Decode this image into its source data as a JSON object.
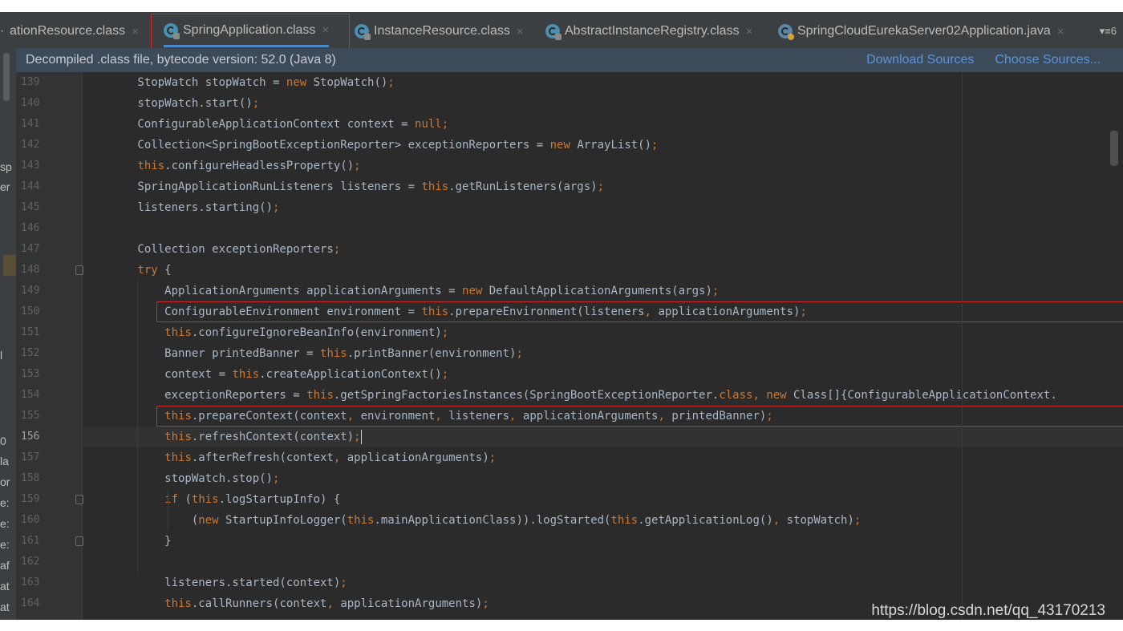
{
  "tabs": [
    {
      "label": "ationResource.class",
      "kind": "class",
      "active": false
    },
    {
      "label": "SpringApplication.class",
      "kind": "class",
      "active": true
    },
    {
      "label": "InstanceResource.class",
      "kind": "class",
      "active": false
    },
    {
      "label": "AbstractInstanceRegistry.class",
      "kind": "class",
      "active": false
    },
    {
      "label": "SpringCloudEurekaServer02Application.java",
      "kind": "java",
      "active": false
    }
  ],
  "tab_close_glyph": "×",
  "tab_overflow_label": "▾≡6",
  "left_cut_glyph": "·",
  "banner": {
    "text": "Decompiled .class file, bytecode version: 52.0 (Java 8)",
    "download_sources": "Download Sources",
    "choose_sources": "Choose Sources..."
  },
  "left_strip_fragments": [
    "sp",
    "er",
    "l",
    "0",
    "la",
    "or",
    "e:",
    "e:",
    "e:",
    "af",
    "at",
    "at"
  ],
  "code_lines": [
    {
      "num": "139",
      "tokens": [
        [
          "nm",
          "        StopWatch stopWatch = "
        ],
        [
          "kw",
          "new "
        ],
        [
          "nm",
          "StopWatch()"
        ],
        [
          "pu",
          ";"
        ]
      ]
    },
    {
      "num": "140",
      "tokens": [
        [
          "nm",
          "        stopWatch.start()"
        ],
        [
          "pu",
          ";"
        ]
      ]
    },
    {
      "num": "141",
      "tokens": [
        [
          "nm",
          "        ConfigurableApplicationContext context = "
        ],
        [
          "kw",
          "null"
        ],
        [
          "pu",
          ";"
        ]
      ]
    },
    {
      "num": "142",
      "tokens": [
        [
          "nm",
          "        Collection<SpringBootExceptionReporter> exceptionReporters = "
        ],
        [
          "kw",
          "new "
        ],
        [
          "nm",
          "ArrayList()"
        ],
        [
          "pu",
          ";"
        ]
      ]
    },
    {
      "num": "143",
      "tokens": [
        [
          "nm",
          "        "
        ],
        [
          "kw",
          "this"
        ],
        [
          "nm",
          ".configureHeadlessProperty()"
        ],
        [
          "pu",
          ";"
        ]
      ]
    },
    {
      "num": "144",
      "tokens": [
        [
          "nm",
          "        SpringApplicationRunListeners listeners = "
        ],
        [
          "kw",
          "this"
        ],
        [
          "nm",
          ".getRunListeners(args)"
        ],
        [
          "pu",
          ";"
        ]
      ]
    },
    {
      "num": "145",
      "tokens": [
        [
          "nm",
          "        listeners.starting()"
        ],
        [
          "pu",
          ";"
        ]
      ]
    },
    {
      "num": "146",
      "tokens": []
    },
    {
      "num": "147",
      "tokens": [
        [
          "nm",
          "        Collection exceptionReporters"
        ],
        [
          "pu",
          ";"
        ]
      ]
    },
    {
      "num": "148",
      "tokens": [
        [
          "nm",
          "        "
        ],
        [
          "kw",
          "try "
        ],
        [
          "nm",
          "{"
        ]
      ]
    },
    {
      "num": "149",
      "tokens": [
        [
          "nm",
          "            ApplicationArguments applicationArguments = "
        ],
        [
          "kw",
          "new "
        ],
        [
          "nm",
          "DefaultApplicationArguments(args)"
        ],
        [
          "pu",
          ";"
        ]
      ]
    },
    {
      "num": "150",
      "tokens": [
        [
          "nm",
          "            ConfigurableEnvironment environment = "
        ],
        [
          "kw",
          "this"
        ],
        [
          "nm",
          ".prepareEnvironment(listeners"
        ],
        [
          "pu",
          ", "
        ],
        [
          "nm",
          "applicationArguments)"
        ],
        [
          "pu",
          ";"
        ]
      ]
    },
    {
      "num": "151",
      "tokens": [
        [
          "nm",
          "            "
        ],
        [
          "kw",
          "this"
        ],
        [
          "nm",
          ".configureIgnoreBeanInfo(environment)"
        ],
        [
          "pu",
          ";"
        ]
      ]
    },
    {
      "num": "152",
      "tokens": [
        [
          "nm",
          "            Banner printedBanner = "
        ],
        [
          "kw",
          "this"
        ],
        [
          "nm",
          ".printBanner(environment)"
        ],
        [
          "pu",
          ";"
        ]
      ]
    },
    {
      "num": "153",
      "tokens": [
        [
          "nm",
          "            context = "
        ],
        [
          "kw",
          "this"
        ],
        [
          "nm",
          ".createApplicationContext()"
        ],
        [
          "pu",
          ";"
        ]
      ]
    },
    {
      "num": "154",
      "tokens": [
        [
          "nm",
          "            exceptionReporters = "
        ],
        [
          "kw",
          "this"
        ],
        [
          "nm",
          ".getSpringFactoriesInstances(SpringBootExceptionReporter."
        ],
        [
          "kw",
          "class"
        ],
        [
          "pu",
          ", "
        ],
        [
          "kw",
          "new "
        ],
        [
          "nm",
          "Class[]{ConfigurableApplicationContext."
        ]
      ]
    },
    {
      "num": "155",
      "tokens": [
        [
          "nm",
          "            "
        ],
        [
          "kw",
          "this"
        ],
        [
          "nm",
          ".prepareContext(context"
        ],
        [
          "pu",
          ", "
        ],
        [
          "nm",
          "environment"
        ],
        [
          "pu",
          ", "
        ],
        [
          "nm",
          "listeners"
        ],
        [
          "pu",
          ", "
        ],
        [
          "nm",
          "applicationArguments"
        ],
        [
          "pu",
          ", "
        ],
        [
          "nm",
          "printedBanner)"
        ],
        [
          "pu",
          ";"
        ]
      ]
    },
    {
      "num": "156",
      "tokens": [
        [
          "nm",
          "            "
        ],
        [
          "kw",
          "this"
        ],
        [
          "nm",
          ".refreshContext(context)"
        ],
        [
          "pu",
          ";"
        ]
      ]
    },
    {
      "num": "157",
      "tokens": [
        [
          "nm",
          "            "
        ],
        [
          "kw",
          "this"
        ],
        [
          "nm",
          ".afterRefresh(context"
        ],
        [
          "pu",
          ", "
        ],
        [
          "nm",
          "applicationArguments)"
        ],
        [
          "pu",
          ";"
        ]
      ]
    },
    {
      "num": "158",
      "tokens": [
        [
          "nm",
          "            stopWatch.stop()"
        ],
        [
          "pu",
          ";"
        ]
      ]
    },
    {
      "num": "159",
      "tokens": [
        [
          "nm",
          "            "
        ],
        [
          "kw",
          "if "
        ],
        [
          "nm",
          "("
        ],
        [
          "kw",
          "this"
        ],
        [
          "nm",
          ".logStartupInfo) {"
        ]
      ]
    },
    {
      "num": "160",
      "tokens": [
        [
          "nm",
          "                ("
        ],
        [
          "kw",
          "new "
        ],
        [
          "nm",
          "StartupInfoLogger("
        ],
        [
          "kw",
          "this"
        ],
        [
          "nm",
          ".mainApplicationClass)).logStarted("
        ],
        [
          "kw",
          "this"
        ],
        [
          "nm",
          ".getApplicationLog()"
        ],
        [
          "pu",
          ", "
        ],
        [
          "nm",
          "stopWatch)"
        ],
        [
          "pu",
          ";"
        ]
      ]
    },
    {
      "num": "161",
      "tokens": [
        [
          "nm",
          "            }"
        ]
      ]
    },
    {
      "num": "162",
      "tokens": []
    },
    {
      "num": "163",
      "tokens": [
        [
          "nm",
          "            listeners.started(context)"
        ],
        [
          "pu",
          ";"
        ]
      ]
    },
    {
      "num": "164",
      "tokens": [
        [
          "nm",
          "            "
        ],
        [
          "kw",
          "this"
        ],
        [
          "nm",
          ".callRunners(context"
        ],
        [
          "pu",
          ", "
        ],
        [
          "nm",
          "applicationArguments)"
        ],
        [
          "pu",
          ";"
        ]
      ]
    }
  ],
  "current_line": "156",
  "fold_marker_lines": [
    "148",
    "159",
    "161"
  ],
  "bulb_line": "156",
  "highlighted_lines": [
    "150",
    "155"
  ],
  "watermark": "https://blog.csdn.net/qq_43170213",
  "colors": {
    "editor_bg": "#2b2b2b",
    "keyword": "#cc7832",
    "identifier": "#a9b7c6",
    "annotation_box": "#d12b2b",
    "link": "#5d95d6",
    "banner_bg": "#3d4a5a"
  }
}
